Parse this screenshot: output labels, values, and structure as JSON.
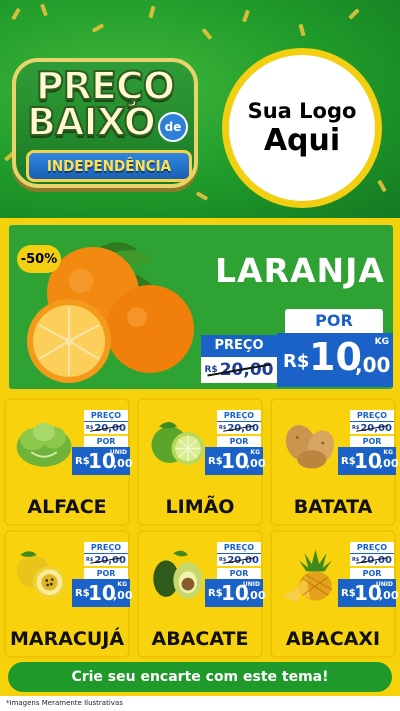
{
  "header": {
    "badge": {
      "line1": "PREÇO",
      "line2": "BAIXO",
      "de": "de",
      "ribbon": "INDEPENDÊNCIA"
    },
    "logo": {
      "line1": "Sua Logo",
      "line2": "Aqui"
    }
  },
  "featured": {
    "discount": "-50%",
    "name": "LARANJA",
    "old_label": "PREÇO",
    "old_currency": "R$",
    "old_price": "20,00",
    "new_label": "POR",
    "currency": "R$",
    "price_int": "10",
    "price_dec": ",00",
    "unit": "KG"
  },
  "products": [
    {
      "name": "ALFACE",
      "old_label": "PREÇO",
      "old_currency": "R$",
      "old_price": "20,00",
      "new_label": "POR",
      "currency": "R$",
      "price_int": "10",
      "price_dec": ",00",
      "unit": "UNID",
      "icon": "lettuce-icon"
    },
    {
      "name": "LIMÃO",
      "old_label": "PREÇO",
      "old_currency": "R$",
      "old_price": "20,00",
      "new_label": "POR",
      "currency": "R$",
      "price_int": "10",
      "price_dec": ",00",
      "unit": "KG",
      "icon": "lime-icon"
    },
    {
      "name": "BATATA",
      "old_label": "PREÇO",
      "old_currency": "R$",
      "old_price": "20,00",
      "new_label": "POR",
      "currency": "R$",
      "price_int": "10",
      "price_dec": ",00",
      "unit": "KG",
      "icon": "potato-icon"
    },
    {
      "name": "MARACUJÁ",
      "old_label": "PREÇO",
      "old_currency": "R$",
      "old_price": "20,00",
      "new_label": "POR",
      "currency": "R$",
      "price_int": "10",
      "price_dec": ",00",
      "unit": "KG",
      "icon": "passion-fruit-icon"
    },
    {
      "name": "ABACATE",
      "old_label": "PREÇO",
      "old_currency": "R$",
      "old_price": "20,00",
      "new_label": "POR",
      "currency": "R$",
      "price_int": "10",
      "price_dec": ",00",
      "unit": "UNID",
      "icon": "avocado-icon"
    },
    {
      "name": "ABACAXI",
      "old_label": "PREÇO",
      "old_currency": "R$",
      "old_price": "20,00",
      "new_label": "POR",
      "currency": "R$",
      "price_int": "10",
      "price_dec": ",00",
      "unit": "UNID",
      "icon": "pineapple-icon"
    }
  ],
  "footer": {
    "cta": "Crie seu encarte com este tema!",
    "disclaimer": "*Imagens Meramente Ilustrativas"
  },
  "colors": {
    "green": "#1f9a2a",
    "yellow": "#f6d20a",
    "blue": "#1b62c8"
  }
}
